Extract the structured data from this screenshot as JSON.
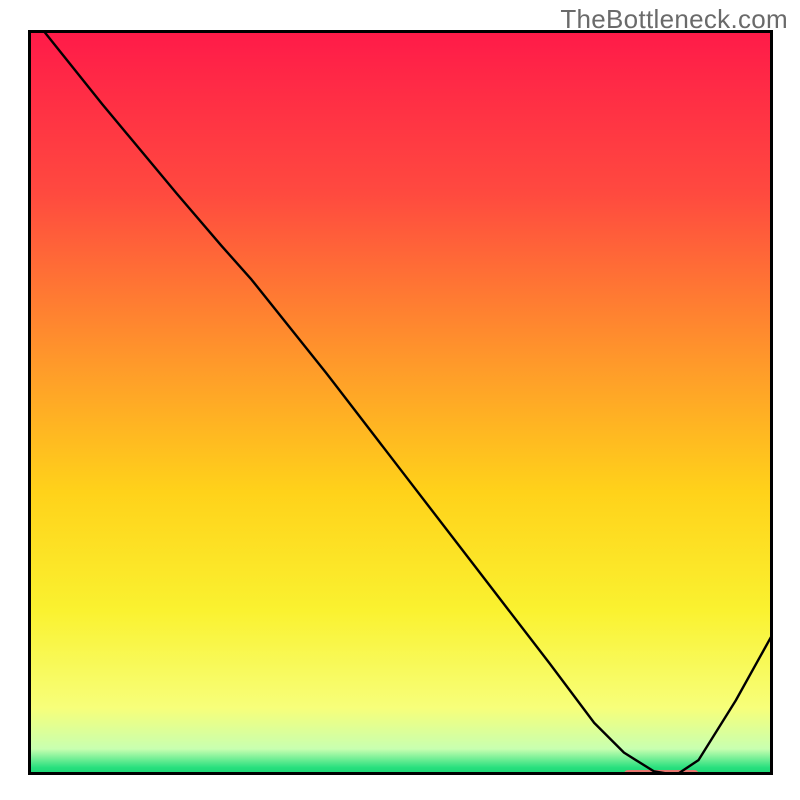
{
  "chart_data": {
    "type": "line",
    "watermark": "TheBottleneck.com",
    "title": "",
    "xlabel": "",
    "ylabel": "",
    "xlim": [
      0,
      100
    ],
    "ylim": [
      0,
      100
    ],
    "grid": false,
    "background_gradient_stops": [
      {
        "pos": 0.0,
        "color": "#ff1a49"
      },
      {
        "pos": 0.22,
        "color": "#ff4a3f"
      },
      {
        "pos": 0.45,
        "color": "#ff9a2a"
      },
      {
        "pos": 0.62,
        "color": "#ffd21a"
      },
      {
        "pos": 0.78,
        "color": "#faf230"
      },
      {
        "pos": 0.91,
        "color": "#f7ff7a"
      },
      {
        "pos": 0.965,
        "color": "#c8ffb0"
      },
      {
        "pos": 0.99,
        "color": "#28e07e"
      },
      {
        "pos": 1.0,
        "color": "#17d472"
      }
    ],
    "series": [
      {
        "name": "bottleneck-curve",
        "color": "#000000",
        "stroke_width": 2.4,
        "x": [
          2,
          10,
          20,
          26,
          30,
          40,
          50,
          60,
          70,
          76,
          80,
          84,
          87,
          90,
          95,
          100
        ],
        "y": [
          100,
          90,
          78,
          71,
          66.5,
          54,
          41,
          28,
          15,
          7,
          3,
          0.5,
          0,
          2,
          10,
          19
        ]
      }
    ],
    "marker": {
      "name": "optimal-range-marker",
      "color": "#e8766f",
      "x_start": 80,
      "x_end": 90,
      "y": 0,
      "thickness_px": 8,
      "cap_radius_px": 4
    },
    "axes": {
      "show_ticks": false,
      "frame_color": "#000000",
      "frame_width": 3
    },
    "legend": {
      "show": false
    }
  }
}
